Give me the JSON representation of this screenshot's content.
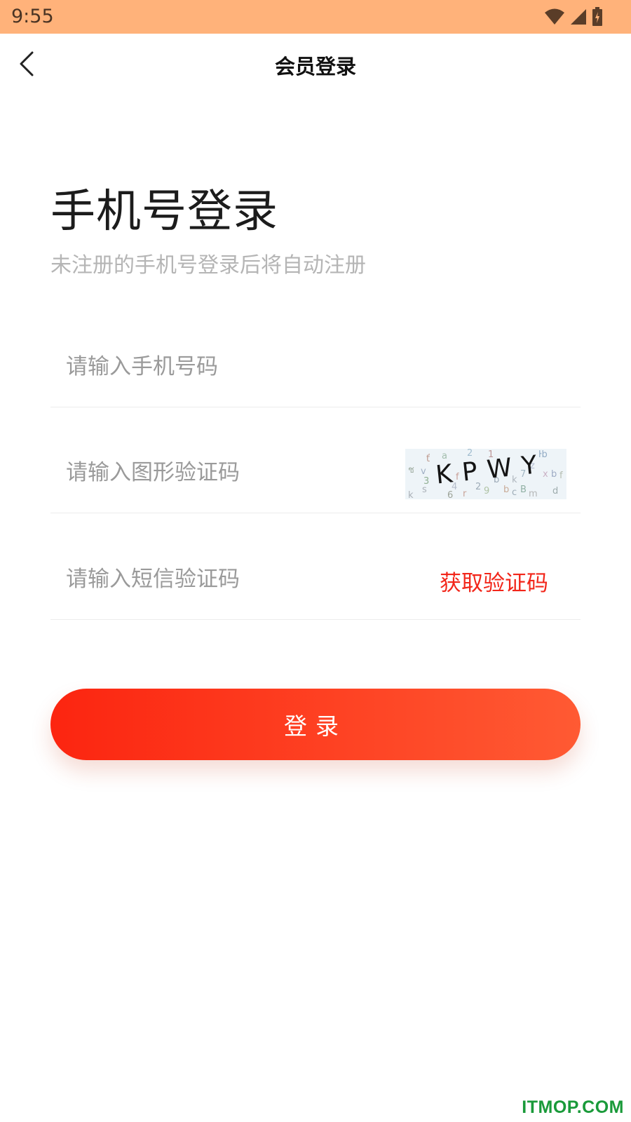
{
  "status_bar": {
    "time": "9:55",
    "icons": [
      "wifi-icon",
      "signal-icon",
      "battery-charging-icon"
    ]
  },
  "nav": {
    "title": "会员登录",
    "back_icon": "chevron-left-icon"
  },
  "main": {
    "headline": "手机号登录",
    "subtitle": "未注册的手机号登录后将自动注册",
    "phone_placeholder": "请输入手机号码",
    "captcha_placeholder": "请输入图形验证码",
    "captcha_text": "KPWY",
    "sms_placeholder": "请输入短信验证码",
    "sms_button": "获取验证码",
    "login_button": "登录"
  },
  "watermark": "ITMOP.COM",
  "colors": {
    "status_bar": "#ffb27a",
    "accent": "#f2261a",
    "button_start": "#fc2510",
    "button_end": "#ff5a33",
    "watermark": "#1a9a3a"
  }
}
